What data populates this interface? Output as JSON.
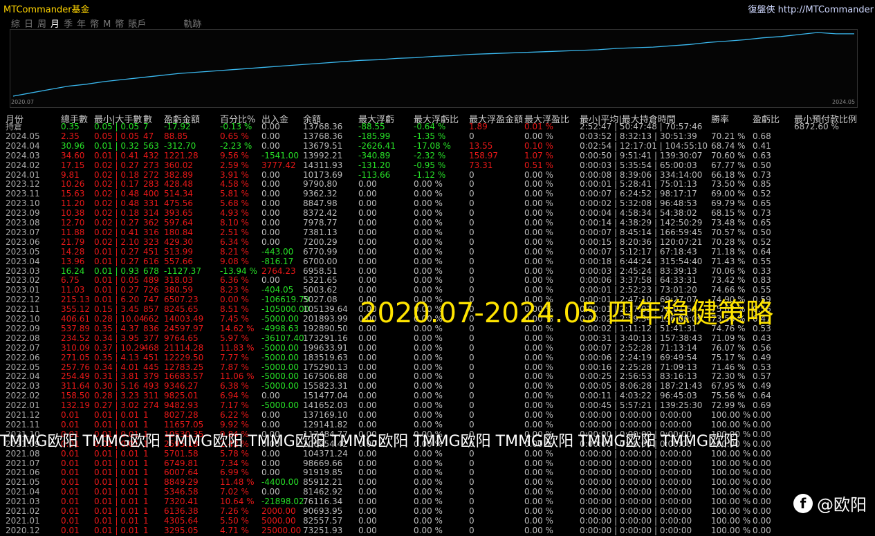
{
  "app": {
    "title": "MTCommander基金",
    "right_title": "復盤俠 http://MTCommander"
  },
  "tabs": [
    "綜",
    "日",
    "周",
    "月",
    "季",
    "年",
    "幣",
    "M",
    "幣",
    "賬戶",
    "軌跡"
  ],
  "chart_axis": {
    "start": "2020.07",
    "end": "2024.05"
  },
  "chart_data": {
    "type": "line",
    "x": [
      "2020.07",
      "2020.08",
      "2020.09",
      "2020.10",
      "2020.11",
      "2020.12",
      "2021.01",
      "2021.02",
      "2021.03",
      "2021.04",
      "2021.05",
      "2021.06",
      "2021.07",
      "2021.08",
      "2021.09",
      "2021.10",
      "2021.11",
      "2021.12",
      "2022.01",
      "2022.02",
      "2022.03",
      "2022.04",
      "2022.05",
      "2022.06",
      "2022.07",
      "2022.08",
      "2022.09",
      "2022.10",
      "2022.11",
      "2022.12",
      "2023.01",
      "2023.02",
      "2023.03",
      "2023.04",
      "2023.05",
      "2023.06",
      "2023.07",
      "2023.08",
      "2023.09",
      "2023.10",
      "2023.11",
      "2023.12",
      "2024.01",
      "2024.02",
      "2024.03",
      "2024.04",
      "2024.05"
    ],
    "y": [
      0,
      5,
      10,
      15,
      18,
      22,
      25,
      28,
      31,
      34,
      36,
      38,
      40,
      42,
      44,
      46,
      48,
      50,
      52,
      54,
      55,
      57,
      58,
      60,
      61,
      63,
      64,
      65,
      66,
      67,
      68,
      69,
      70,
      72,
      73,
      74,
      76,
      78,
      81,
      83,
      85,
      88,
      90,
      93,
      96,
      94,
      94
    ]
  },
  "headers": [
    "月份",
    "總手數",
    "最小|大手數",
    "數",
    "盈虧金額",
    "百分比%",
    "出入金",
    "余額",
    "最大浮虧",
    "最大浮虧比",
    "最大浮盈金額",
    "最大浮盈比",
    "最小|平均|最大持倉時間",
    "勝率",
    "盈虧比",
    "最小預付款比例"
  ],
  "holding_extra": "6872.60 %",
  "rows": [
    [
      "持倉",
      "0.35",
      "0.05 | 0.05",
      "7",
      "-17.92",
      "-0.13 %",
      "0.00",
      "13768.36",
      "-88.55",
      "-0.64 %",
      "1.89",
      "0.01 %",
      "2:52:47 | 50:47:48 | 70:57:46",
      "",
      ""
    ],
    [
      "2024.05",
      "2.35",
      "0.05 | 0.05",
      "47",
      "88.85",
      "0.65 %",
      "0.00",
      "13768.36",
      "-185.99",
      "-1.35 %",
      "0",
      "0.00 %",
      "0:03:52 | 8:32:13 | 30:51:39",
      "70.21 %",
      "0.68"
    ],
    [
      "2024.04",
      "30.96",
      "0.01 | 0.32",
      "563",
      "-312.70",
      "-2.23 %",
      "0.00",
      "13679.51",
      "-2626.41",
      "-17.08 %",
      "13.55",
      "0.10 %",
      "0:02:54 | 12:17:01 | 104:55:10",
      "68.74 %",
      "0.41"
    ],
    [
      "2024.03",
      "34.60",
      "0.01 | 0.41",
      "432",
      "1221.28",
      "9.56 %",
      "-1541.00",
      "13992.21",
      "-340.89",
      "-2.32 %",
      "158.97",
      "1.07 %",
      "0:00:50 | 9:51:41 | 139:30:07",
      "70.60 %",
      "0.63"
    ],
    [
      "2024.02",
      "17.15",
      "0.02 | 0.27",
      "273",
      "360.02",
      "2.59 %",
      "3777.42",
      "14311.93",
      "-131.20",
      "-0.95 %",
      "73.31",
      "0.51 %",
      "0:00:03 | 5:35:54 | 65:00:03",
      "67.77 %",
      "0.50"
    ],
    [
      "2024.01",
      "9.81",
      "0.02 | 0.18",
      "272",
      "382.89",
      "3.91 %",
      "0.00",
      "10173.69",
      "-113.66",
      "-1.12 %",
      "0",
      "0.00 %",
      "0:00:08 | 8:39:06 | 334:14:00",
      "66.18 %",
      "0.73"
    ],
    [
      "2023.12",
      "10.26",
      "0.02 | 0.17",
      "283",
      "428.48",
      "4.58 %",
      "0.00",
      "9790.80",
      "0.00",
      "0.00 %",
      "0",
      "0.00 %",
      "0:00:01 | 5:28:41 | 75:01:13",
      "73.50 %",
      "0.85"
    ],
    [
      "2023.11",
      "15.63",
      "0.02 | 0.48",
      "400",
      "514.34",
      "5.81 %",
      "0.00",
      "9362.32",
      "0.00",
      "0.00 %",
      "0",
      "0.00 %",
      "0:00:07 | 6:24:52 | 98:17:17",
      "69.00 %",
      "0.52"
    ],
    [
      "2023.10",
      "11.20",
      "0.02 | 0.48",
      "331",
      "475.56",
      "5.68 %",
      "0.00",
      "8847.98",
      "0.00",
      "0.00 %",
      "0",
      "0.00 %",
      "0:00:02 | 5:32:08 | 96:48:53",
      "69.79 %",
      "0.65"
    ],
    [
      "2023.09",
      "10.38",
      "0.02 | 0.18",
      "314",
      "393.65",
      "4.93 %",
      "0.00",
      "8372.42",
      "0.00",
      "0.00 %",
      "0",
      "0.00 %",
      "0:00:04 | 4:58:34 | 54:38:02",
      "68.15 %",
      "0.73"
    ],
    [
      "2023.08",
      "12.70",
      "0.02 | 0.27",
      "362",
      "597.64",
      "8.10 %",
      "0.00",
      "7978.77",
      "0.00",
      "0.00 %",
      "0",
      "0.00 %",
      "0:00:14 | 4:38:29 | 142:50:29",
      "73.48 %",
      "0.65"
    ],
    [
      "2023.07",
      "11.88",
      "0.02 | 0.41",
      "316",
      "180.84",
      "2.51 %",
      "0.00",
      "7381.13",
      "0.00",
      "0.00 %",
      "0",
      "0.00 %",
      "0:00:07 | 8:45:14 | 166:59:45",
      "70.57 %",
      "0.50"
    ],
    [
      "2023.06",
      "21.79",
      "0.02 | 2.10",
      "323",
      "429.30",
      "6.34 %",
      "0.00",
      "7200.29",
      "0.00",
      "0.00 %",
      "0",
      "0.00 %",
      "0:00:15 | 8:20:36 | 120:07:21",
      "70.28 %",
      "0.52"
    ],
    [
      "2023.05",
      "14.28",
      "0.01 | 0.27",
      "451",
      "513.99",
      "8.21 %",
      "-443.00",
      "6770.99",
      "0.00",
      "0.00 %",
      "0",
      "0.00 %",
      "0:00:07 | 5:12:17 | 67:18:43",
      "71.18 %",
      "0.64"
    ],
    [
      "2023.04",
      "13.96",
      "0.01 | 0.27",
      "616",
      "557.66",
      "9.08 %",
      "-816.17",
      "6700.00",
      "0.00",
      "0.00 %",
      "0",
      "0.00 %",
      "0:00:18 | 6:44:24 | 315:54:40",
      "71.43 %",
      "0.55"
    ],
    [
      "2023.03",
      "16.24",
      "0.01 | 0.93",
      "678",
      "-1127.37",
      "-13.94 %",
      "2764.23",
      "6958.51",
      "0.00",
      "0.00 %",
      "0",
      "0.00 %",
      "0:00:03 | 2:45:24 | 83:39:13",
      "70.06 %",
      "0.33"
    ],
    [
      "2023.02",
      "6.75",
      "0.01 | 0.05",
      "489",
      "318.03",
      "6.36 %",
      "0.00",
      "5321.65",
      "0.00",
      "0.00 %",
      "0",
      "0.00 %",
      "0:00:06 | 3:37:58 | 64:33:31",
      "73.42 %",
      "0.83"
    ],
    [
      "2023.01",
      "11.03",
      "0.01 | 0.27",
      "726",
      "380.59",
      "8.23 %",
      "-404.05",
      "5003.62",
      "0.00",
      "0.00 %",
      "0",
      "0.00 %",
      "0:00:01 | 2:52:23 | 73:01:20",
      "74.66 %",
      "0.55"
    ],
    [
      "2022.12",
      "215.13",
      "0.01 | 6.20",
      "747",
      "6507.23",
      "0.00 %",
      "-106619.79",
      "5027.08",
      "0.00",
      "0.00 %",
      "0",
      "0.00 %",
      "0:00:01 | 2:47:10 | 69:27:07",
      "74.90 %",
      "0.59"
    ],
    [
      "2022.11",
      "355.12",
      "0.15 | 3.45",
      "857",
      "8245.65",
      "8.51 %",
      "-105000.00",
      "105139.64",
      "0.00",
      "0.00 %",
      "0",
      "0.00 %",
      "0:00:01 | 2:17:01 | 70:01:56",
      "75.62 %",
      "0.56"
    ],
    [
      "2022.10",
      "406.61",
      "0.28 | 10.04",
      "662",
      "14003.49",
      "7.45 %",
      "-5000.00",
      "201893.99",
      "0.00",
      "0.00 %",
      "0",
      "0.00 %",
      "0:00:02 | 2:59:34 | 136:00:09",
      "73.56 %",
      "0.47"
    ],
    [
      "2022.09",
      "537.89",
      "0.35 | 4.37",
      "836",
      "24597.97",
      "14.62 %",
      "-4998.63",
      "192890.50",
      "0.00",
      "0.00 %",
      "0",
      "0.00 %",
      "0:00:02 | 1:11:12 | 51:41:31",
      "74.76 %",
      "0.53"
    ],
    [
      "2022.08",
      "234.52",
      "0.34 | 3.95",
      "377",
      "9764.65",
      "5.97 %",
      "-36107.40",
      "173291.16",
      "0.00",
      "0.00 %",
      "0",
      "0.00 %",
      "0:00:31 | 3:40:13 | 157:38:43",
      "71.09 %",
      "0.43"
    ],
    [
      "2022.07",
      "310.09",
      "0.37 | 10.29",
      "468",
      "21114.28",
      "11.83 %",
      "-5000.00",
      "199633.91",
      "0.00",
      "0.00 %",
      "0",
      "0.00 %",
      "0:00:07 | 2:52:28 | 71:13:14",
      "76.07 %",
      "0.56"
    ],
    [
      "2022.06",
      "271.05",
      "0.35 | 4.13",
      "451",
      "12229.50",
      "7.77 %",
      "-5000.00",
      "183519.63",
      "0.00",
      "0.00 %",
      "0",
      "0.00 %",
      "0:00:06 | 2:24:19 | 69:49:54",
      "75.17 %",
      "0.49"
    ],
    [
      "2022.05",
      "257.76",
      "0.34 | 4.01",
      "445",
      "12783.25",
      "7.87 %",
      "-5000.00",
      "175290.13",
      "0.00",
      "0.00 %",
      "0",
      "0.00 %",
      "0:00:16 | 2:25:28 | 71:09:13",
      "71.46 %",
      "0.53"
    ],
    [
      "2022.04",
      "254.49",
      "0.31 | 3.81",
      "379",
      "16683.57",
      "11.06 %",
      "-5000.00",
      "167506.88",
      "0.00",
      "0.00 %",
      "0",
      "0.00 %",
      "0:00:25 | 2:56:53 | 83:16:13",
      "72.30 %",
      "0.57"
    ],
    [
      "2022.03",
      "311.64",
      "0.30 | 5.16",
      "493",
      "9346.27",
      "6.38 %",
      "-5000.00",
      "155823.31",
      "0.00",
      "0.00 %",
      "0",
      "0.00 %",
      "0:00:05 | 8:06:28 | 187:21:43",
      "67.95 %",
      "0.49"
    ],
    [
      "2022.02",
      "158.50",
      "0.28 | 3.23",
      "311",
      "9825.01",
      "6.94 %",
      "0.00",
      "151477.04",
      "0.00",
      "0.00 %",
      "0",
      "0.00 %",
      "0:00:11 | 4:03:22 | 96:45:03",
      "75.56 %",
      "0.64"
    ],
    [
      "2022.01",
      "132.19",
      "0.27 | 3.02",
      "274",
      "9482.93",
      "7.17 %",
      "-5000.00",
      "141652.03",
      "0.00",
      "0.00 %",
      "0",
      "0.00 %",
      "0:00:45 | 5:57:21 | 139:25:30",
      "72.99 %",
      "0.69"
    ],
    [
      "2021.12",
      "0.01",
      "0.01 | 0.01",
      "1",
      "8027.28",
      "6.22 %",
      "0.00",
      "137169.10",
      "0.00",
      "0.00 %",
      "0",
      "0.00 %",
      "0:00:00 | 0:00:00 | 0:00:00",
      "100.00 %",
      "0.00"
    ],
    [
      "2021.11",
      "0.01",
      "0.01 | 0.01",
      "1",
      "11657.05",
      "9.92 %",
      "0.00",
      "129141.82",
      "0.00",
      "0.00 %",
      "0",
      "0.00 %",
      "0:00:00 | 0:00:00 | 0:00:00",
      "100.00 %",
      "0.00"
    ],
    [
      "2021.10",
      "0.01",
      "0.01 | 0.01",
      "1",
      "10530.35",
      "9.84 %",
      "0.00",
      "117484.77",
      "0.00",
      "0.00 %",
      "0",
      "0.00 %",
      "0:00:00 | 0:00:00 | 0:00:00",
      "100.00 %",
      "0.00"
    ],
    [
      "2021.09",
      "0.01",
      "0.01 | 0.01",
      "1",
      "2595.18",
      "2.42 %",
      "0.00",
      "106954.42",
      "0.00",
      "0.00 %",
      "0",
      "0.00 %",
      "0:00:00 | 0:00:00 | 0:00:00",
      "100.00 %",
      "0.00"
    ],
    [
      "2021.08",
      "0.01",
      "0.01 | 0.01",
      "1",
      "5701.58",
      "5.78 %",
      "0.00",
      "104371.24",
      "0.00",
      "0.00 %",
      "0",
      "0.00 %",
      "0:00:00 | 0:00:00 | 0:00:00",
      "100.00 %",
      "0.00"
    ],
    [
      "2021.07",
      "0.01",
      "0.01 | 0.01",
      "1",
      "6749.81",
      "7.34 %",
      "0.00",
      "98669.66",
      "0.00",
      "0.00 %",
      "0",
      "0.00 %",
      "0:00:00 | 0:00:00 | 0:00:00",
      "100.00 %",
      "0.00"
    ],
    [
      "2021.06",
      "0.01",
      "0.01 | 0.01",
      "1",
      "6007.64",
      "6.99 %",
      "0.00",
      "91919.85",
      "0.00",
      "0.00 %",
      "0",
      "0.00 %",
      "0:00:00 | 0:00:00 | 0:00:00",
      "100.00 %",
      "0.00"
    ],
    [
      "2021.05",
      "0.01",
      "0.01 | 0.01",
      "1",
      "8849.29",
      "11.48 %",
      "-4400.00",
      "85912.21",
      "0.00",
      "0.00 %",
      "0",
      "0.00 %",
      "0:00:00 | 0:00:00 | 0:00:00",
      "100.00 %",
      "0.00"
    ],
    [
      "2021.04",
      "0.01",
      "0.01 | 0.01",
      "1",
      "5346.58",
      "7.02 %",
      "0.00",
      "81462.92",
      "0.00",
      "0.00 %",
      "0",
      "0.00 %",
      "0:00:00 | 0:00:00 | 0:00:00",
      "100.00 %",
      "0.00"
    ],
    [
      "2021.03",
      "0.01",
      "0.01 | 0.01",
      "1",
      "7320.41",
      "10.64 %",
      "-21898.02",
      "76116.34",
      "0.00",
      "0.00 %",
      "0",
      "0.00 %",
      "0:00:00 | 0:00:00 | 0:00:00",
      "100.00 %",
      "0.00"
    ],
    [
      "2021.02",
      "0.01",
      "0.01 | 0.01",
      "1",
      "6136.38",
      "7.26 %",
      "2000.00",
      "90693.95",
      "0.00",
      "0.00 %",
      "0",
      "0.00 %",
      "0:00:00 | 0:00:00 | 0:00:00",
      "100.00 %",
      "0.00"
    ],
    [
      "2021.01",
      "0.01",
      "0.01 | 0.01",
      "1",
      "4305.64",
      "5.50 %",
      "5000.00",
      "82557.57",
      "0.00",
      "0.00 %",
      "0",
      "0.00 %",
      "0:00:00 | 0:00:00 | 0:00:00",
      "100.00 %",
      "0.00"
    ],
    [
      "2020.12",
      "0.01",
      "0.01 | 0.01",
      "1",
      "3295.05",
      "4.71 %",
      "25000.00",
      "73251.93",
      "0.00",
      "0.00 %",
      "0",
      "0.00 %",
      "0:00:00 | 0:00:00 | 0:00:00",
      "100.00 %",
      "0.00"
    ]
  ],
  "overlays": {
    "headline": "2020.07-2024.05 四年稳健策略",
    "watermark": "TMMG欧阳 TMMG欧阳 TMMG欧阳 TMMG欧阳 TMMG欧阳 TMMG欧阳 TMMG欧阳 TMMG欧阳 TMMG欧阳",
    "fb_text": "@欧阳"
  }
}
